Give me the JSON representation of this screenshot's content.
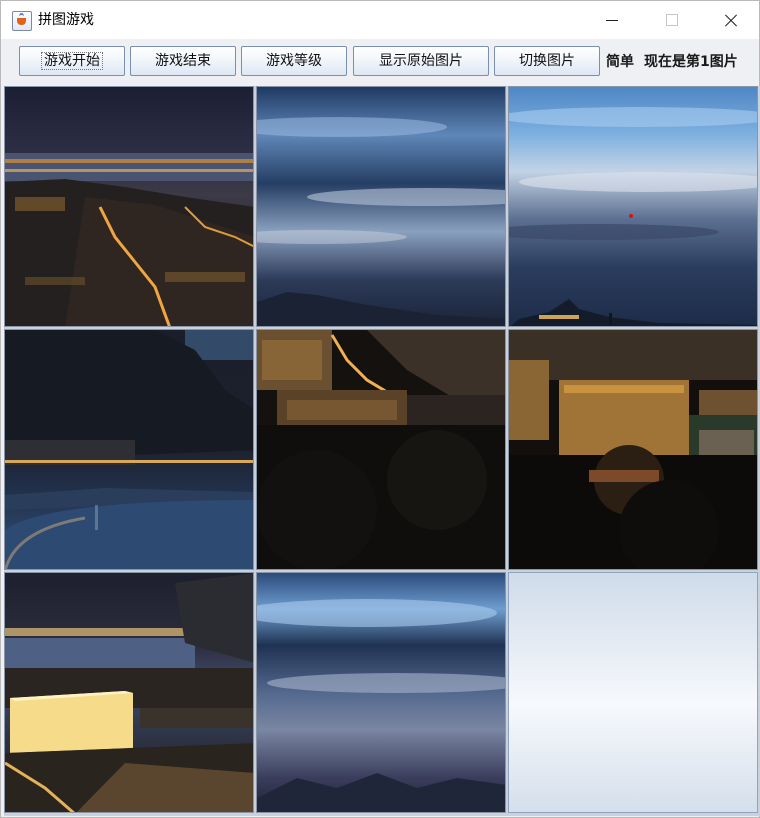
{
  "window": {
    "title": "拼图游戏",
    "icon": "java-cup-icon"
  },
  "toolbar": {
    "buttons": [
      {
        "label": "游戏开始"
      },
      {
        "label": "游戏结束"
      },
      {
        "label": "游戏等级"
      },
      {
        "label": "显示原始图片"
      },
      {
        "label": "切换图片"
      }
    ],
    "level_text": "简单",
    "status_text": "现在是第1图片"
  },
  "board": {
    "rows": 3,
    "cols": 3,
    "tiles": [
      {
        "content": "city-lights-bay"
      },
      {
        "content": "cloudy-sky-hill"
      },
      {
        "content": "cloudy-sky-mountain-town"
      },
      {
        "content": "dark-hill-shoreline"
      },
      {
        "content": "street-buildings-night"
      },
      {
        "content": "lit-buildings-trees"
      },
      {
        "content": "waterfront-glowing-building"
      },
      {
        "content": "cloudy-sky-mountains"
      },
      {
        "content": "empty"
      }
    ]
  },
  "colors": {
    "button_border": "#7b8fb0",
    "empty_tile": "#e6edf5",
    "dot": "#e30b0b"
  }
}
